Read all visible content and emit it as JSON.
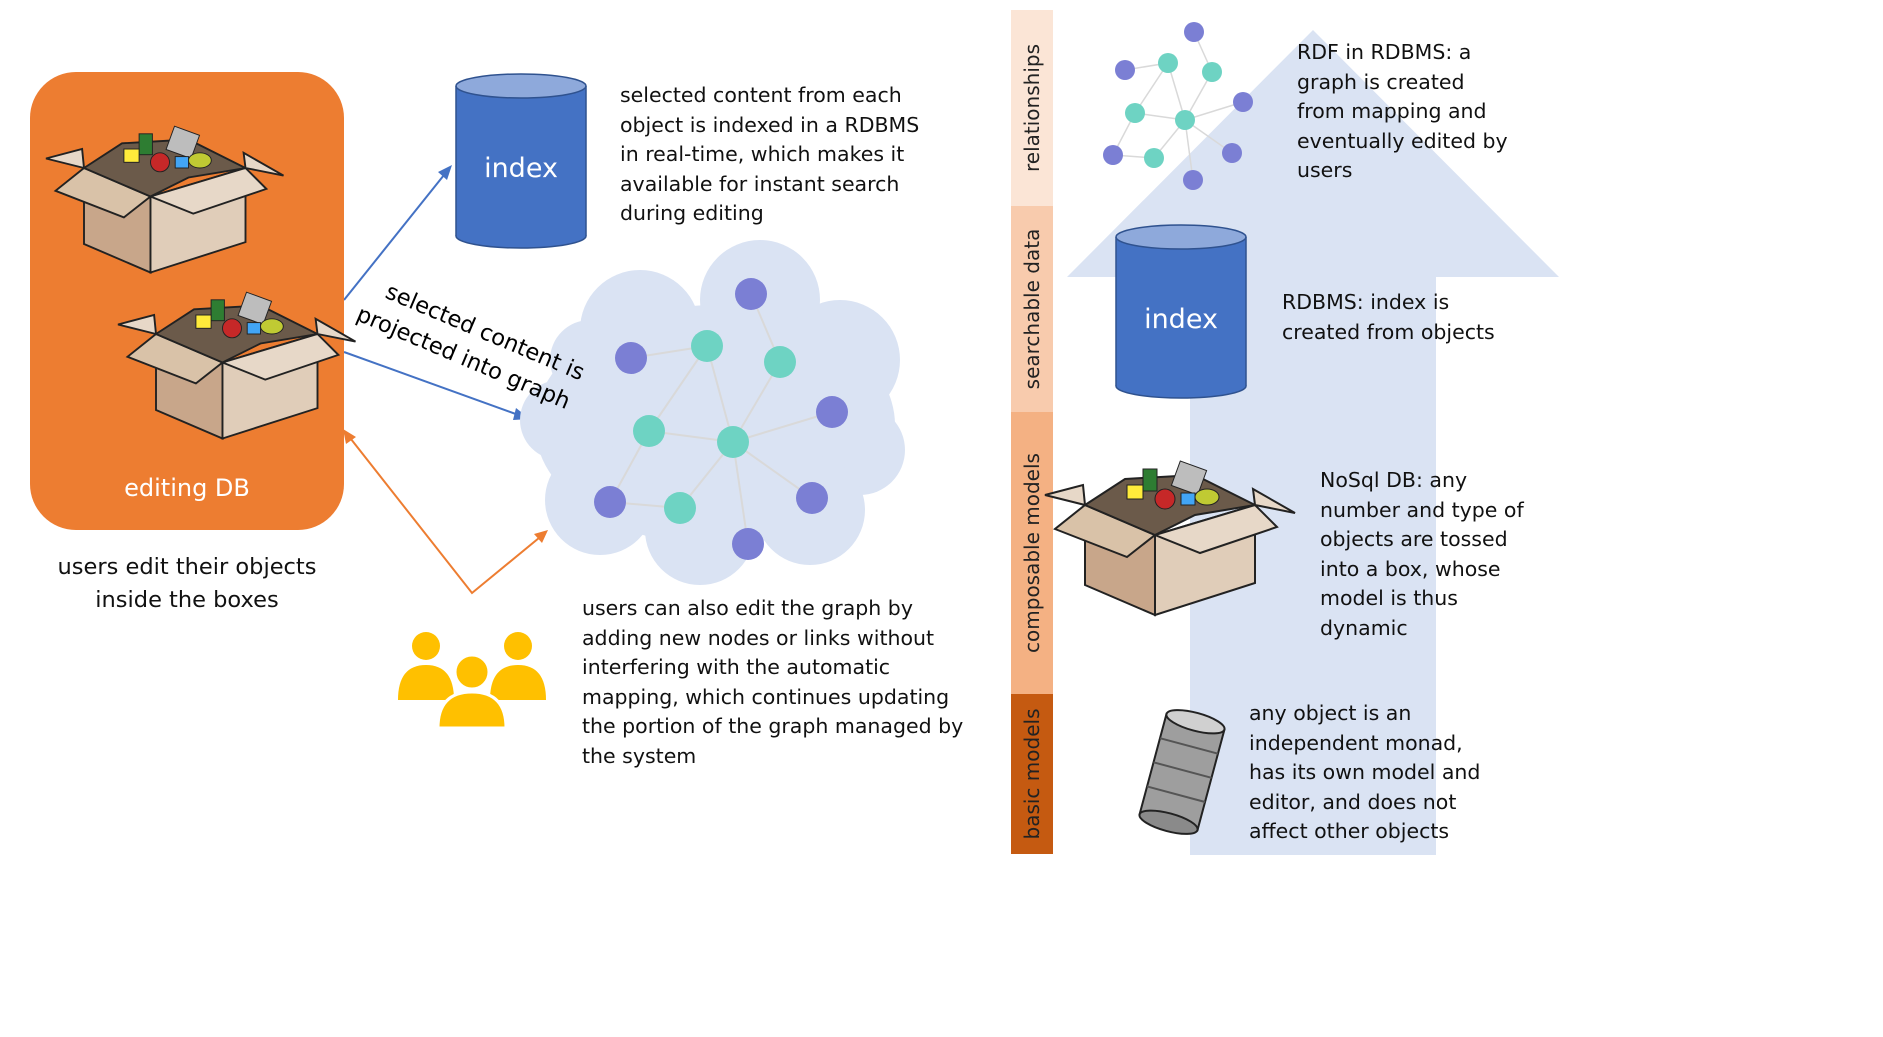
{
  "left_panel": {
    "box_label": "editing DB",
    "caption_line1": "users edit their objects",
    "caption_line2": "inside the boxes",
    "box_color": "#ED7D31"
  },
  "index_db": {
    "label": "index",
    "description": [
      "selected content from each",
      "object is indexed in a RDBMS",
      "in real-time, which makes it",
      "available for instant search",
      "during editing"
    ],
    "color": "#4472C4"
  },
  "projection": {
    "line1": "selected content is",
    "line2": "projected into graph"
  },
  "users_edit": {
    "icon": "users-group-icon",
    "description": [
      "users can also edit the graph by",
      "adding new nodes or links without",
      "interfering with the automatic",
      "mapping, which continues updating",
      "the portion of the graph managed by",
      "the system"
    ],
    "icon_color": "#FFC000"
  },
  "stages": [
    {
      "label": "relationships",
      "color": "#FBE5D6"
    },
    {
      "label": "searchable data",
      "color": "#F8CBAD"
    },
    {
      "label": "composable models",
      "color": "#F4B183"
    },
    {
      "label": "basic models",
      "color": "#C55A11"
    }
  ],
  "right_panel": {
    "rdf": [
      "RDF in RDBMS: a",
      "graph is created",
      "from mapping and",
      "eventually edited by",
      "users"
    ],
    "index_label": "index",
    "rdbms": [
      "RDBMS: index is",
      "created from objects"
    ],
    "nosql": [
      "NoSql DB: any",
      "number and type of",
      "objects are tossed",
      "into a box, whose",
      "model is thus",
      "dynamic"
    ],
    "monad": [
      "any object is an",
      "independent monad,",
      "has its own model and",
      "editor, and does not",
      "affect other objects"
    ],
    "arrow_color": "#DAE3F3"
  },
  "colors": {
    "graph_node_purple": "#7B7FD4",
    "graph_node_teal": "#6ED3C3",
    "cloud": "#DAE3F3",
    "arrow_blue": "#4472C4",
    "arrow_orange": "#ED7D31"
  }
}
